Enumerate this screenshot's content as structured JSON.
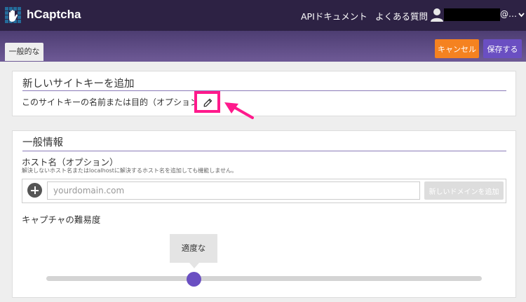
{
  "header": {
    "brand": "hCaptcha",
    "nav": {
      "api_docs": "APIドキュメント",
      "faq": "よくある質問"
    },
    "user": {
      "email_suffix": "@…"
    }
  },
  "subbar": {
    "tab_general": "一般的な",
    "cancel_label": "キャンセル",
    "save_label": "保存する"
  },
  "new_sitekey": {
    "title": "新しいサイトキーを追加",
    "name_label": "このサイトキーの名前または目的（オプション）"
  },
  "general_info": {
    "title": "一般情報",
    "host_label": "ホスト名（オプション）",
    "host_help": "解決しないホスト名またはlocalhostに解決するホスト名を追加しても機能しません。",
    "host_placeholder": "yourdomain.com",
    "add_domain_label": "新しいドメインを追加",
    "difficulty_label": "キャプチャの難易度",
    "difficulty_value": "適度な",
    "difficulty_level": 0.34
  },
  "colors": {
    "topbar": "#2d2244",
    "accent": "#6a4fc2",
    "cancel": "#f58220",
    "highlight": "#ff1a8c"
  },
  "icons": [
    "hcaptcha-logo-icon",
    "user-icon",
    "chevron-down-icon",
    "pencil-icon",
    "plus-circle-icon",
    "pink-arrow-annotation"
  ]
}
